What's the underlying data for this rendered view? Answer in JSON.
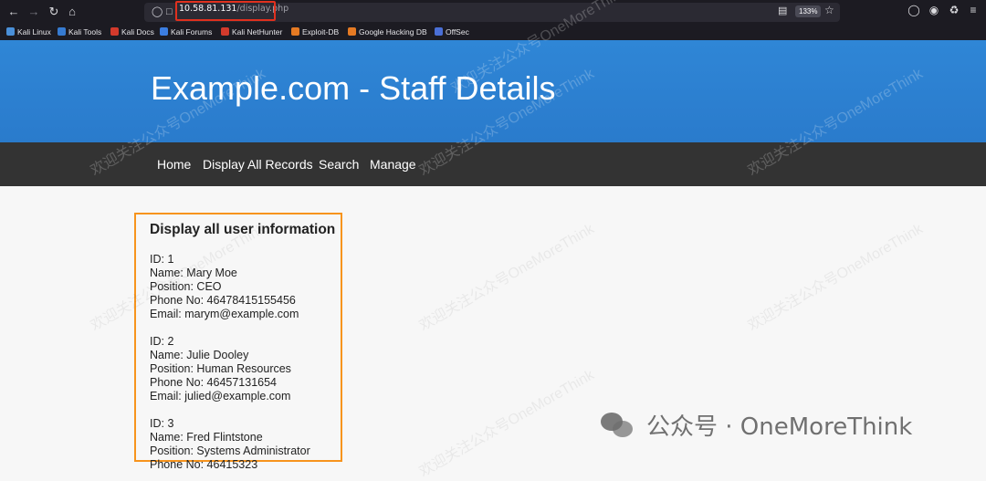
{
  "browser": {
    "url_host": "10.58.81.131",
    "url_path": "/display.php",
    "zoom": "133%"
  },
  "bookmarks": [
    {
      "label": "Kali Linux",
      "color": "#4a90d9"
    },
    {
      "label": "Kali Tools",
      "color": "#367bd1"
    },
    {
      "label": "Kali Docs",
      "color": "#d33a2c"
    },
    {
      "label": "Kali Forums",
      "color": "#3b7de0"
    },
    {
      "label": "Kali NetHunter",
      "color": "#d33a2c"
    },
    {
      "label": "Exploit-DB",
      "color": "#e57a23"
    },
    {
      "label": "Google Hacking DB",
      "color": "#e57a23"
    },
    {
      "label": "OffSec",
      "color": "#4a6fd6"
    }
  ],
  "site": {
    "title": "Example.com - Staff Details",
    "nav": [
      "Home",
      "Display All Records",
      "Search",
      "Manage"
    ]
  },
  "content": {
    "heading": "Display all user information",
    "records": [
      {
        "id": "ID: 1",
        "name": "Name: Mary Moe",
        "position": "Position: CEO",
        "phone": "Phone No: 46478415155456",
        "email": "Email: marym@example.com"
      },
      {
        "id": "ID: 2",
        "name": "Name: Julie Dooley",
        "position": "Position: Human Resources",
        "phone": "Phone No: 46457131654",
        "email": "Email: julied@example.com"
      },
      {
        "id": "ID: 3",
        "name": "Name: Fred Flintstone",
        "position": "Position: Systems Administrator",
        "phone": "Phone No: 46415323"
      }
    ]
  },
  "watermark": {
    "text": "欢迎关注公众号OneMoreThink",
    "brand": "公众号 · OneMoreThink"
  },
  "colors": {
    "header": "#2f86d6",
    "nav": "#333333",
    "highlight_box": "#f7941d",
    "url_highlight": "#e0301e"
  }
}
